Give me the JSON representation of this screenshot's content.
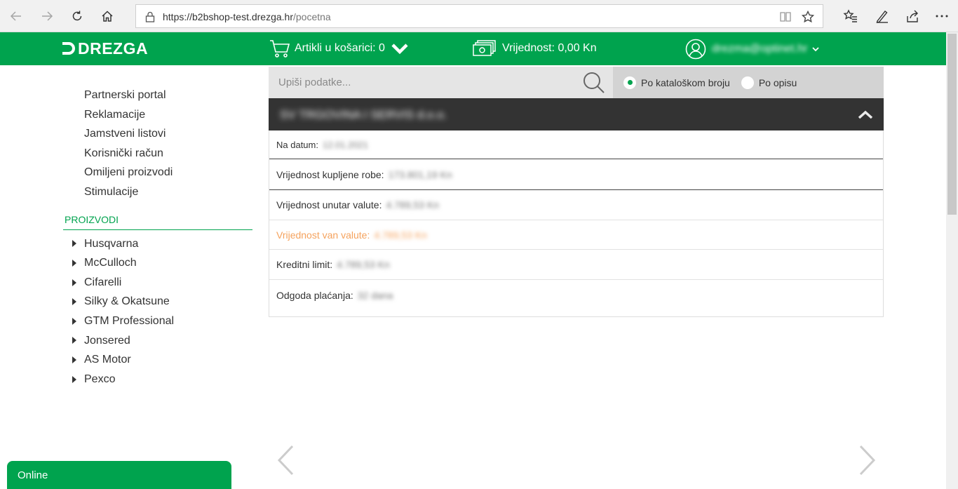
{
  "browser": {
    "url_host": "https://b2bshop-test.drezga.hr",
    "url_path": "/pocetna"
  },
  "header": {
    "logo_text": "DREZGA",
    "cart_label": "Artikli u košarici: 0",
    "value_label": "Vrijednost: 0,00 Kn",
    "user_email": "drezma@optinet.hr",
    "brand_color": "#00a34e"
  },
  "sidebar": {
    "links": [
      "Partnerski portal",
      "Reklamacije",
      "Jamstveni listovi",
      "Korisnički račun",
      "Omiljeni proizvodi",
      "Stimulacije"
    ],
    "section_title": "PROIZVODI",
    "categories": [
      "Husqvarna",
      "McCulloch",
      "Cifarelli",
      "Silky & Okatsune",
      "GTM Professional",
      "Jonsered",
      "AS Motor",
      "Pexco"
    ]
  },
  "search": {
    "placeholder": "Upiši podatke...",
    "options": [
      {
        "label": "Po kataloškom broju",
        "checked": true
      },
      {
        "label": "Po opisu",
        "checked": false
      }
    ]
  },
  "account": {
    "title": "SV TRGOVINA I SERVIS d.o.o.",
    "rows": [
      {
        "label": "Na datum:",
        "value": "12.01.2021"
      },
      {
        "label": "Vrijednost kupljene robe:",
        "value": "173.801,19 Kn"
      },
      {
        "label": "Vrijednost unutar valute:",
        "value": "4.789,53 Kn"
      },
      {
        "label": "Vrijednost van valute:",
        "value": "4.789,53 Kn"
      },
      {
        "label": "Kreditni limit:",
        "value": "4.789,53 Kn"
      },
      {
        "label": "Odgoda plaćanja:",
        "value": "32 dana"
      }
    ]
  },
  "chat": {
    "label": "Online"
  }
}
